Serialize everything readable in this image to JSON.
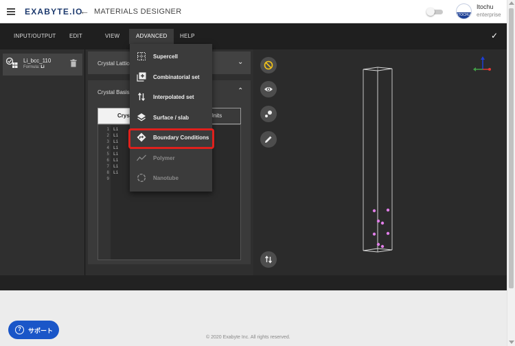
{
  "header": {
    "logo_text": "EXABYTE.IO",
    "app_title": "MATERIALS DESIGNER",
    "user_name": "Itochu",
    "user_role": "enterprise",
    "avatar_text": "ITOCHU"
  },
  "menubar": {
    "items": [
      "INPUT/OUTPUT",
      "EDIT",
      "VIEW",
      "ADVANCED",
      "HELP"
    ],
    "active": "ADVANCED"
  },
  "material": {
    "name": "Li_bcc_110",
    "formula_label": "Formula:",
    "formula": "Li"
  },
  "panels": {
    "lattice_title": "Crystal Lattice",
    "basis_title": "Crystal Basis",
    "tab_left": "Cryst",
    "tab_right": "Units"
  },
  "editor": {
    "line_numbers": [
      "1",
      "2",
      "3",
      "4",
      "5",
      "6",
      "7",
      "8",
      "9"
    ],
    "lines": [
      "Li",
      "Li",
      "Li",
      "Li",
      "Li",
      "Li",
      "Li",
      "Li",
      ""
    ]
  },
  "dropdown": {
    "items": [
      {
        "label": "Supercell",
        "icon": "grid-icon",
        "enabled": true
      },
      {
        "label": "Combinatorial set",
        "icon": "plus-box-icon",
        "enabled": true
      },
      {
        "label": "Interpolated set",
        "icon": "swap-vertical-icon",
        "enabled": true
      },
      {
        "label": "Surface / slab",
        "icon": "layers-icon",
        "enabled": true
      },
      {
        "label": "Boundary Conditions",
        "icon": "directions-icon",
        "enabled": true,
        "highlighted": true
      },
      {
        "label": "Polymer",
        "icon": "chart-line-icon",
        "enabled": false
      },
      {
        "label": "Nanotube",
        "icon": "circle-dashed-icon",
        "enabled": false
      }
    ]
  },
  "viewer": {
    "tools": [
      "block-icon",
      "eye-icon",
      "atoms-icon",
      "pencil-icon",
      "swap-vertical-icon"
    ],
    "axis_colors": {
      "x": "#e53935",
      "y": "#43a047",
      "z": "#1e3fd6"
    },
    "atom_color": "#e07ee8"
  },
  "footer": {
    "support_label": "サポート",
    "copyright": "© 2020 Exabyte Inc. All rights reserved."
  }
}
